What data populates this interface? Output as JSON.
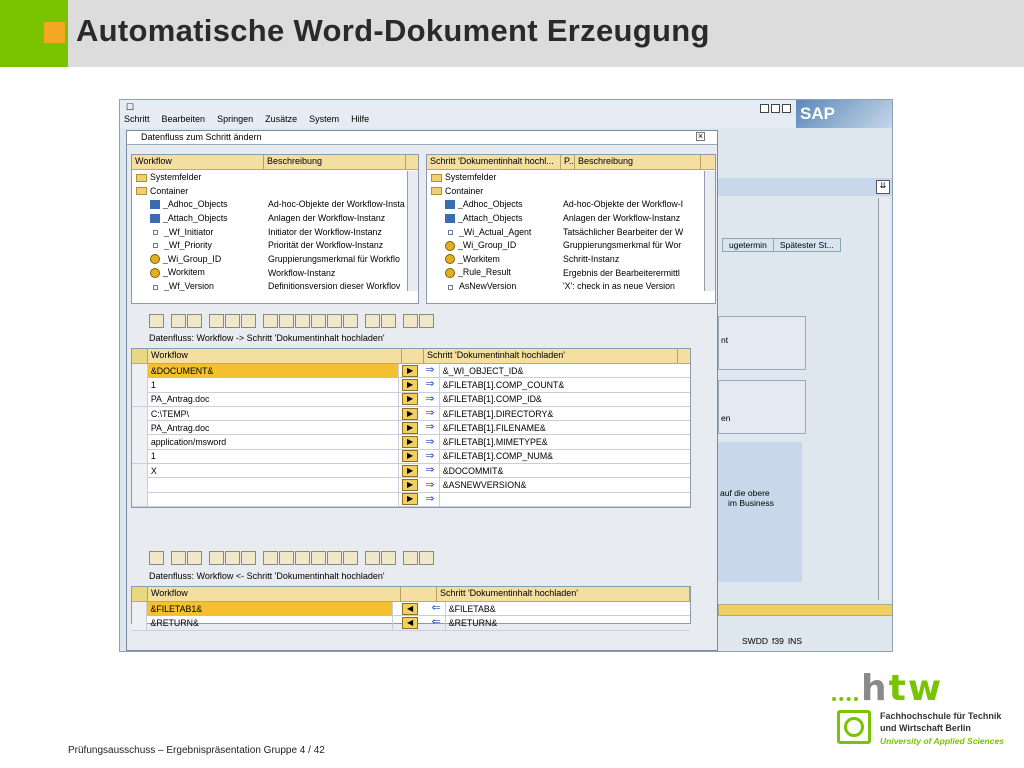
{
  "slide": {
    "title": "Automatische Word-Dokument Erzeugung",
    "footer": "Prüfungsausschuss – Ergebnispräsentation Gruppe 4  /  42",
    "logo": {
      "htw": "htw",
      "name_line1": "Fachhochschule für Technik",
      "name_line2": "und Wirtschaft Berlin",
      "tagline": "University of Applied Sciences"
    }
  },
  "sap": {
    "menu": [
      "Schritt",
      "Bearbeiten",
      "Springen",
      "Zusätze",
      "System",
      "Hilfe"
    ],
    "logo": "SAP",
    "dialog_title": "Datenfluss zum Schritt ändern",
    "left_tree": {
      "headers": [
        "Workflow",
        "Beschreibung"
      ],
      "rows": [
        {
          "name": "Systemfelder",
          "desc": "",
          "icon": "folder-icon"
        },
        {
          "name": "Container",
          "desc": "",
          "icon": "folder-icon"
        },
        {
          "name": "_Adhoc_Objects",
          "desc": "Ad-hoc-Objekte der Workflow-Insta",
          "icon": "grid-icon"
        },
        {
          "name": "_Attach_Objects",
          "desc": "Anlagen der Workflow-Instanz",
          "icon": "grid-icon"
        },
        {
          "name": "_Wf_Initiator",
          "desc": "Initiator der Workflow-Instanz",
          "icon": "field-icon"
        },
        {
          "name": "_Wf_Priority",
          "desc": "Priorität der Workflow-Instanz",
          "icon": "field-icon"
        },
        {
          "name": "_Wi_Group_ID",
          "desc": "Gruppierungsmerkmal für Workflo",
          "icon": "object-icon"
        },
        {
          "name": "_Workitem",
          "desc": "Workflow-Instanz",
          "icon": "object-icon"
        },
        {
          "name": "_Wf_Version",
          "desc": "Definitionsversion dieser Workflov",
          "icon": "field-icon"
        }
      ]
    },
    "right_tree": {
      "headers": [
        "Schritt 'Dokumentinhalt hochl...",
        "P...",
        "Beschreibung"
      ],
      "rows": [
        {
          "name": "Systemfelder",
          "desc": ""
        },
        {
          "name": "Container",
          "desc": ""
        },
        {
          "name": "_Adhoc_Objects",
          "desc": "Ad-hoc-Objekte der Workflow-I"
        },
        {
          "name": "_Attach_Objects",
          "desc": "Anlagen der Workflow-Instanz"
        },
        {
          "name": "_Wi_Actual_Agent",
          "desc": "Tatsächlicher Bearbeiter der W"
        },
        {
          "name": "_Wi_Group_ID",
          "desc": "Gruppierungsmerkmal für Wor"
        },
        {
          "name": "_Workitem",
          "desc": "Schritt-Instanz"
        },
        {
          "name": "_Rule_Result",
          "desc": "Ergebnis der Bearbeiterermittl"
        },
        {
          "name": "AsNewVersion",
          "desc": "'X': check in as neue Version"
        }
      ]
    },
    "flow_in": {
      "title": "Datenfluss: Workflow  -> Schritt 'Dokumentinhalt hochladen'",
      "header_left": "Workflow",
      "header_right": "Schritt 'Dokumentinhalt hochladen'",
      "rows": [
        {
          "left": "&DOCUMENT&",
          "right": "&_WI_OBJECT_ID&"
        },
        {
          "left": "1",
          "right": "&FILETAB[1].COMP_COUNT&"
        },
        {
          "left": "PA_Antrag.doc",
          "right": "&FILETAB[1].COMP_ID&"
        },
        {
          "left": "C:\\TEMP\\",
          "right": "&FILETAB[1].DIRECTORY&"
        },
        {
          "left": "PA_Antrag.doc",
          "right": "&FILETAB[1].FILENAME&"
        },
        {
          "left": "application/msword",
          "right": "&FILETAB[1].MIMETYPE&"
        },
        {
          "left": "1",
          "right": "&FILETAB[1].COMP_NUM&"
        },
        {
          "left": "X",
          "right": "&DOCOMMIT&"
        },
        {
          "left": "",
          "right": "&ASNEWVERSION&"
        },
        {
          "left": "",
          "right": ""
        }
      ]
    },
    "flow_out": {
      "title": "Datenfluss: Workflow  <- Schritt 'Dokumentinhalt hochladen'",
      "header_left": "Workflow",
      "header_right": "Schritt 'Dokumentinhalt hochladen'",
      "rows": [
        {
          "left": "&FILETAB1&",
          "right": "&FILETAB&"
        },
        {
          "left": "&RETURN&",
          "right": "&RETURN&"
        }
      ]
    },
    "background_window": {
      "tabs": [
        "ugetermin",
        "Spätester St..."
      ],
      "texts": [
        "nt",
        "en",
        "auf die obere",
        "im Business"
      ],
      "status": [
        "SWDD",
        "f39",
        "INS"
      ]
    }
  }
}
